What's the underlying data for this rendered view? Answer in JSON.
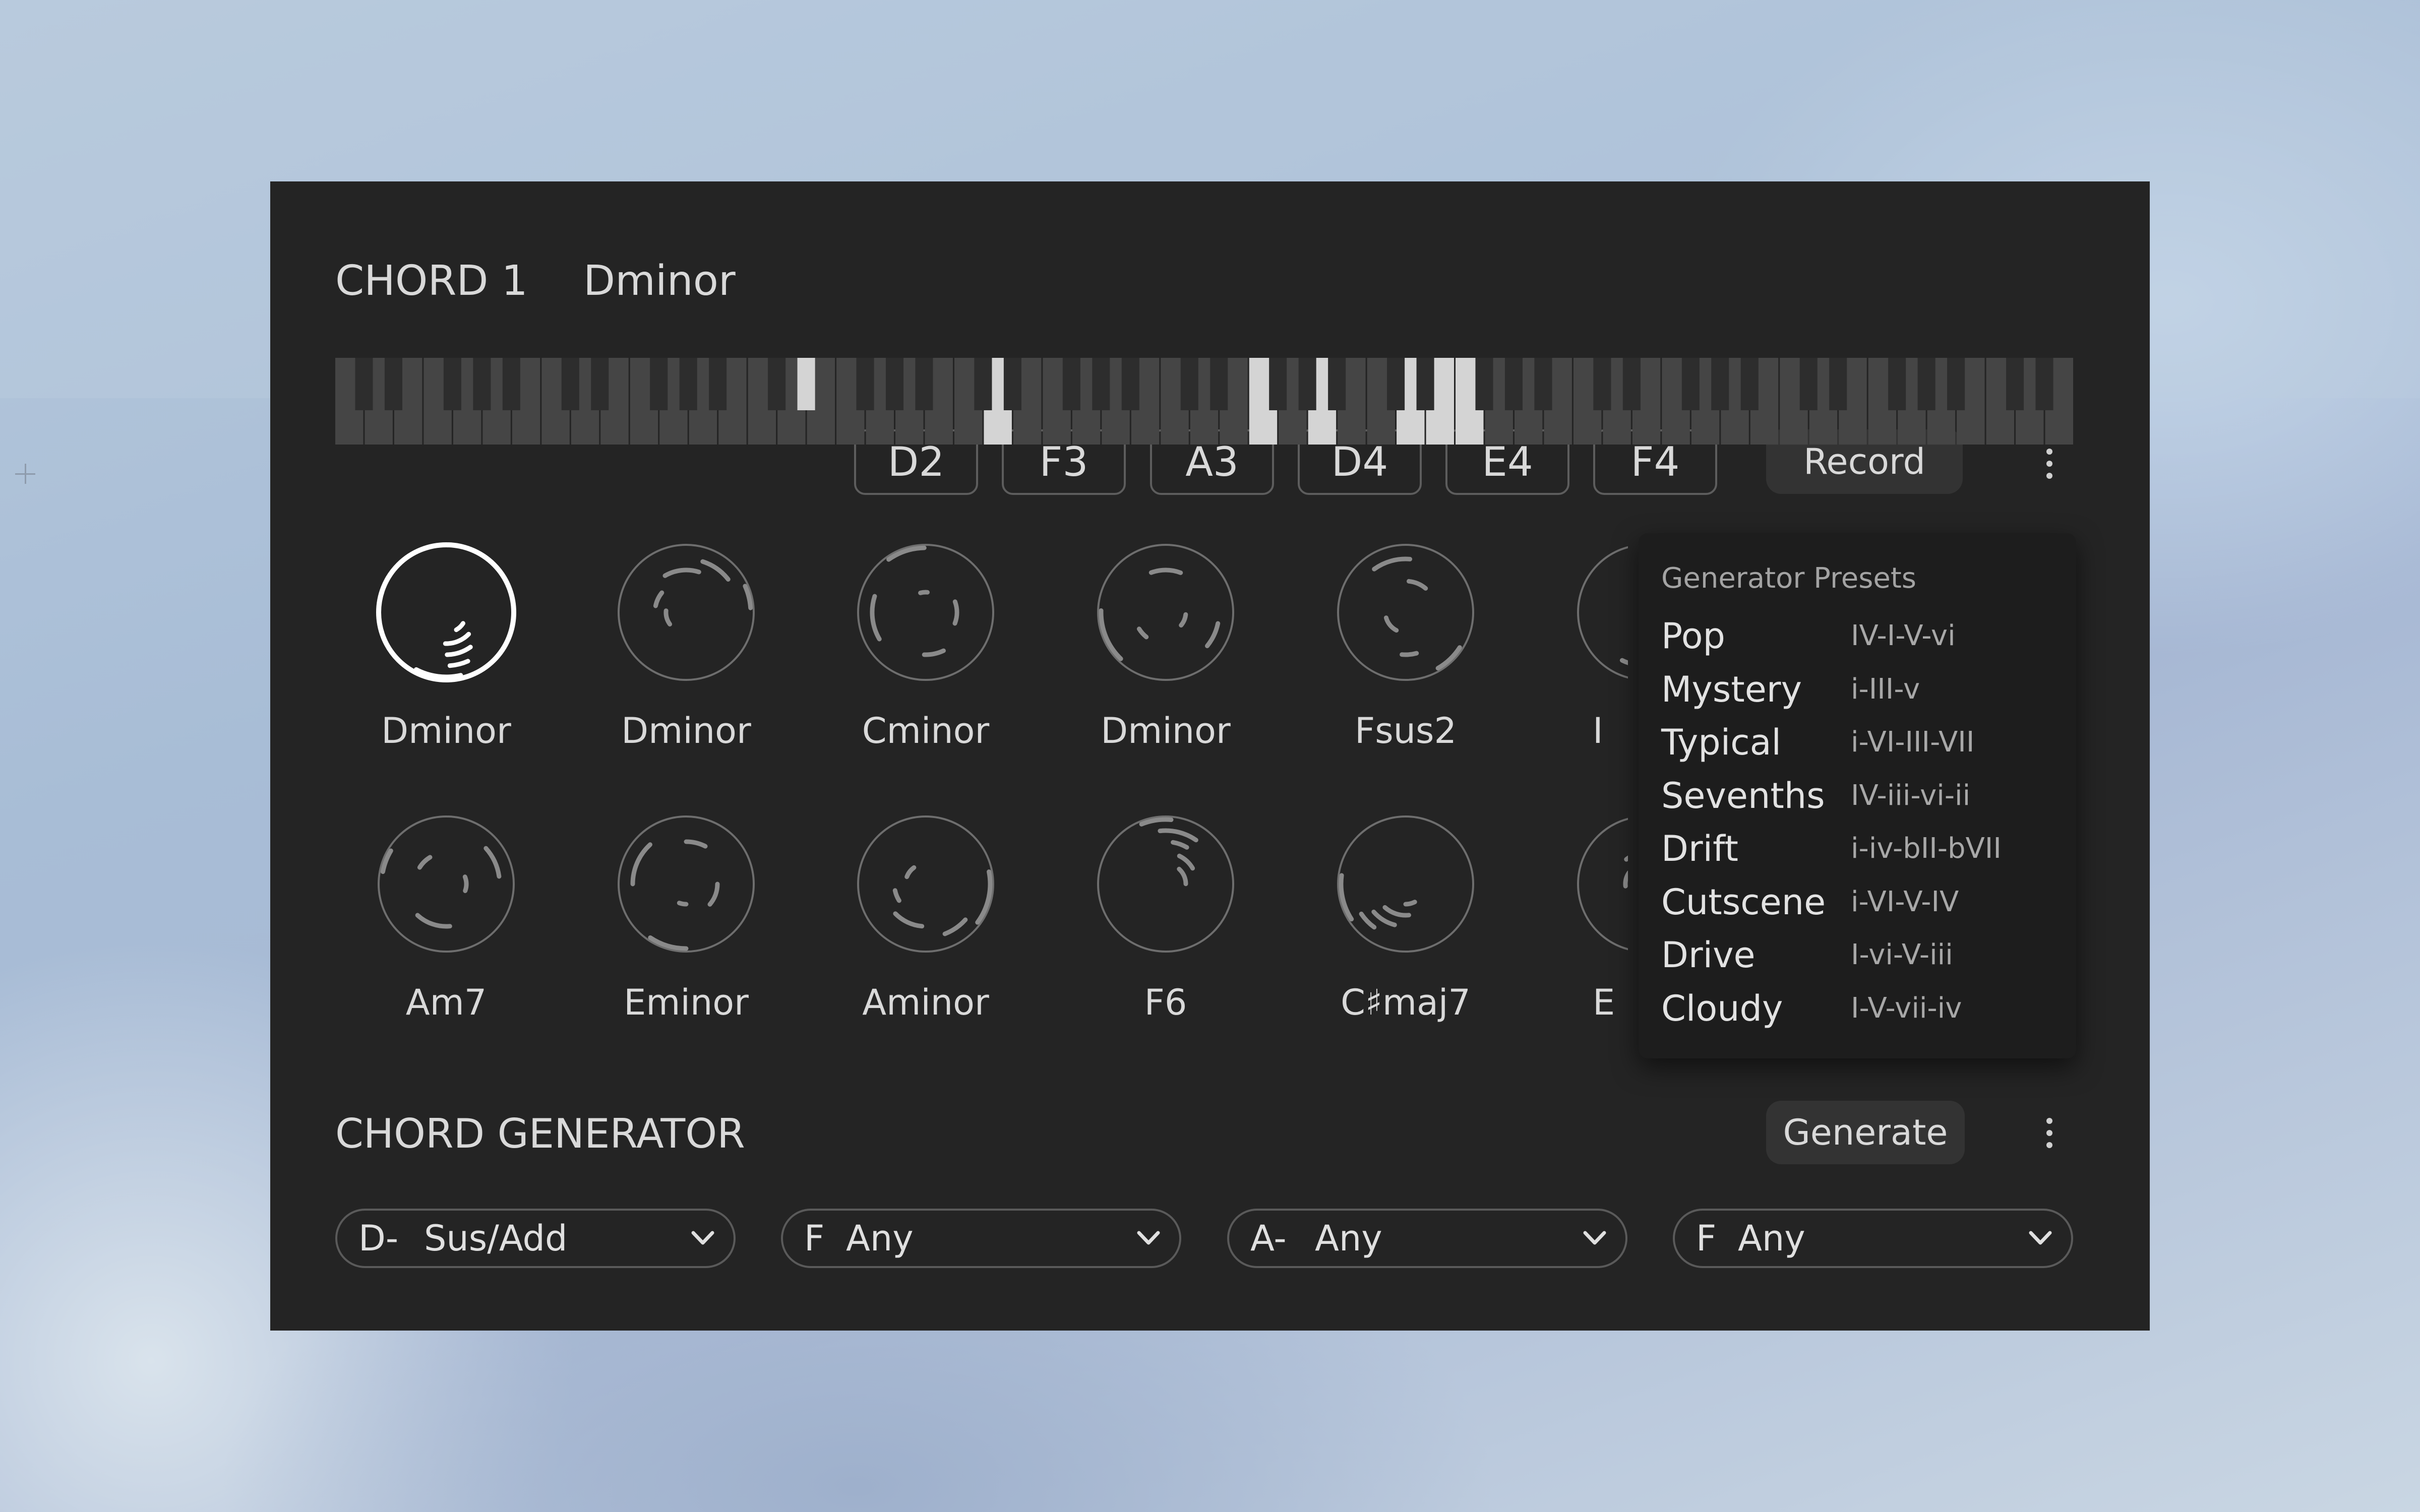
{
  "header": {
    "chord_title": "CHORD 1",
    "chord_name": "Dminor",
    "notes": [
      "D2",
      "F3",
      "A3",
      "D4",
      "E4",
      "F4"
    ],
    "record_label": "Record"
  },
  "keyboard": {
    "white_key_count": 59,
    "pressed_white_keys": [
      22,
      31,
      33,
      36,
      37,
      38
    ],
    "pressed_black_keys": [
      15
    ]
  },
  "knobs": [
    {
      "label": "Dminor",
      "selected": true
    },
    {
      "label": "Dminor",
      "selected": false
    },
    {
      "label": "Cminor",
      "selected": false
    },
    {
      "label": "Dminor",
      "selected": false
    },
    {
      "label": "Fsus2",
      "selected": false
    },
    {
      "label": "I",
      "selected": false
    },
    {
      "label": "Am7",
      "selected": false
    },
    {
      "label": "Eminor",
      "selected": false
    },
    {
      "label": "Aminor",
      "selected": false
    },
    {
      "label": "F6",
      "selected": false
    },
    {
      "label": "C♯maj7",
      "selected": false
    },
    {
      "label": "E",
      "selected": false
    }
  ],
  "presets_menu": {
    "title": "Generator Presets",
    "items": [
      {
        "name": "Pop",
        "progression": "IV-I-V-vi"
      },
      {
        "name": "Mystery",
        "progression": "i-III-v"
      },
      {
        "name": "Typical",
        "progression": "i-VI-III-VII"
      },
      {
        "name": "Sevenths",
        "progression": "IV-iii-vi-ii"
      },
      {
        "name": "Drift",
        "progression": "i-iv-bII-bVII"
      },
      {
        "name": "Cutscene",
        "progression": "i-VI-V-IV"
      },
      {
        "name": "Drive",
        "progression": "I-vi-V-iii"
      },
      {
        "name": "Cloudy",
        "progression": "I-V-vii-iv"
      }
    ]
  },
  "generator": {
    "title": "CHORD GENERATOR",
    "generate_label": "Generate",
    "selects": [
      {
        "note": "D-",
        "type": "Sus/Add"
      },
      {
        "note": "F",
        "type": "Any"
      },
      {
        "note": "A-",
        "type": "Any"
      },
      {
        "note": "F",
        "type": "Any"
      }
    ]
  },
  "colors": {
    "panel": "#242424",
    "key_white": "#454545",
    "key_black": "#2d2d2d",
    "key_pressed": "#d4d4d4",
    "knob_ring": "#6e6e6e",
    "knob_selected": "#ffffff"
  }
}
